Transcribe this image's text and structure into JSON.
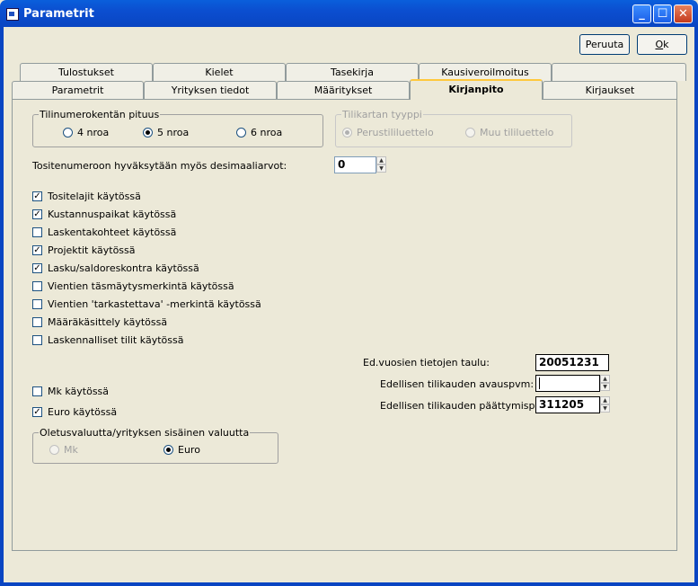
{
  "window": {
    "title": "Parametrit"
  },
  "buttons": {
    "cancel": "Peruuta",
    "ok_first": "O",
    "ok_rest": "k"
  },
  "tabs": {
    "row1": [
      "Tulostukset",
      "Kielet",
      "Tasekirja",
      "Kausiveroilmoitus",
      ""
    ],
    "row2": [
      "Parametrit",
      "Yrityksen tiedot",
      "Määritykset",
      "Kirjanpito",
      "Kirjaukset"
    ]
  },
  "account_length": {
    "legend": "Tilinumerokentän pituus",
    "options": [
      "4 nroa",
      "5 nroa",
      "6 nroa"
    ],
    "selected": "5 nroa"
  },
  "chart_type": {
    "legend": "Tilikartan tyyppi",
    "options": [
      "Perustililuettelo",
      "Muu tililuettelo"
    ],
    "selected": "Perustililuettelo"
  },
  "decimals": {
    "label": "Tositenumeroon hyväksytään myös desimaaliarvot:",
    "value": "0"
  },
  "checks": [
    {
      "label": "Tositelajit käytössä",
      "checked": true
    },
    {
      "label": "Kustannuspaikat käytössä",
      "checked": true
    },
    {
      "label": "Laskentakohteet käytössä",
      "checked": false
    },
    {
      "label": "Projektit käytössä",
      "checked": true
    },
    {
      "label": "Lasku/saldoreskontra käytössä",
      "checked": true
    },
    {
      "label": "Vientien täsmäytysmerkintä käytössä",
      "checked": false
    },
    {
      "label": "Vientien 'tarkastettava' -merkintä käytössä",
      "checked": false
    },
    {
      "label": "Määräkäsittely käytössä",
      "checked": false
    },
    {
      "label": "Laskennalliset tilit käytössä",
      "checked": false
    }
  ],
  "currency_checks": [
    {
      "label": "Mk käytössä",
      "checked": false
    },
    {
      "label": "Euro käytössä",
      "checked": true
    }
  ],
  "default_currency": {
    "legend": "Oletusvaluutta/yrityksen sisäinen valuutta",
    "options": [
      "Mk",
      "Euro"
    ],
    "selected": "Euro"
  },
  "previous_years": {
    "table_label": "Ed.vuosien tietojen taulu:",
    "table_value": "20051231",
    "open_label": "Edellisen tilikauden avauspvm:",
    "open_value": "",
    "close_label": "Edellisen tilikauden päättymispvm:",
    "close_value": "311205"
  }
}
